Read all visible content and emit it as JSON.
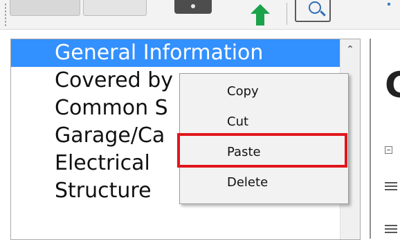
{
  "toolbar": {
    "icons": [
      "new-document-icon",
      "open-folder-icon",
      "save-disk-icon",
      "upload-arrow-icon",
      "search-magnifier-icon"
    ]
  },
  "tree": {
    "items": [
      {
        "label": "General Information",
        "selected": true
      },
      {
        "label": "Covered by"
      },
      {
        "label": "Common S"
      },
      {
        "label": "Garage/Ca"
      },
      {
        "label": "Electrical"
      },
      {
        "label": "Structure"
      }
    ]
  },
  "right_panel": {
    "heading": "G"
  },
  "context_menu": {
    "items": [
      {
        "label": "Copy"
      },
      {
        "label": "Cut"
      },
      {
        "label": "Paste",
        "highlighted": true
      },
      {
        "label": "Delete"
      }
    ]
  },
  "colors": {
    "selection": "#3390ff",
    "highlight": "#e0161d",
    "menu_bg": "#f2f2f2",
    "accent_green": "#1aa34a"
  }
}
